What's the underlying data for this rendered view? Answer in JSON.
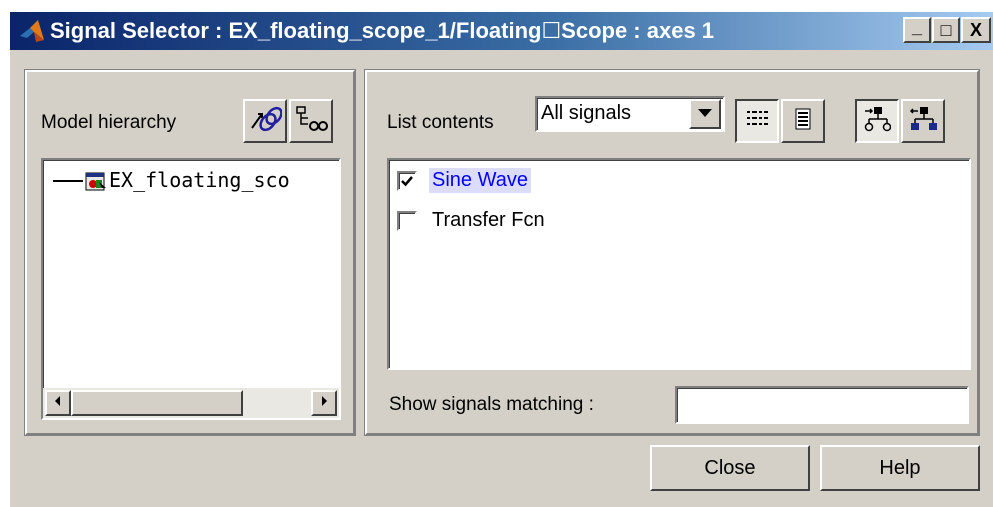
{
  "window": {
    "title": "Signal Selector : EX_floating_scope_1/Floating☐Scope : axes 1",
    "controls": {
      "minimize": "_",
      "maximize": "□",
      "close": "X"
    }
  },
  "left_panel": {
    "label": "Model hierarchy",
    "toolbar": {
      "icon_1": "link-icon",
      "icon_2": "find-icon"
    },
    "tree": {
      "items": [
        {
          "label": "EX_floating_sco"
        }
      ]
    }
  },
  "right_panel": {
    "list_contents": {
      "label": "List contents",
      "selected": "All signals"
    },
    "toolbar": {
      "icon_1": "list-view-icon",
      "icon_2": "detail-view-icon",
      "icon_3": "hierarchy-down-icon",
      "icon_4": "hierarchy-up-icon"
    },
    "signals": [
      {
        "label": "Sine Wave",
        "checked": true
      },
      {
        "label": "Transfer Fcn",
        "checked": false
      }
    ],
    "filter": {
      "label": "Show signals matching :",
      "value": ""
    }
  },
  "footer": {
    "close_label": "Close",
    "help_label": "Help"
  },
  "colors": {
    "title_start": "#0a246a",
    "title_end": "#a6caf0",
    "selection": "#0000ff",
    "face": "#d4d0c8"
  }
}
